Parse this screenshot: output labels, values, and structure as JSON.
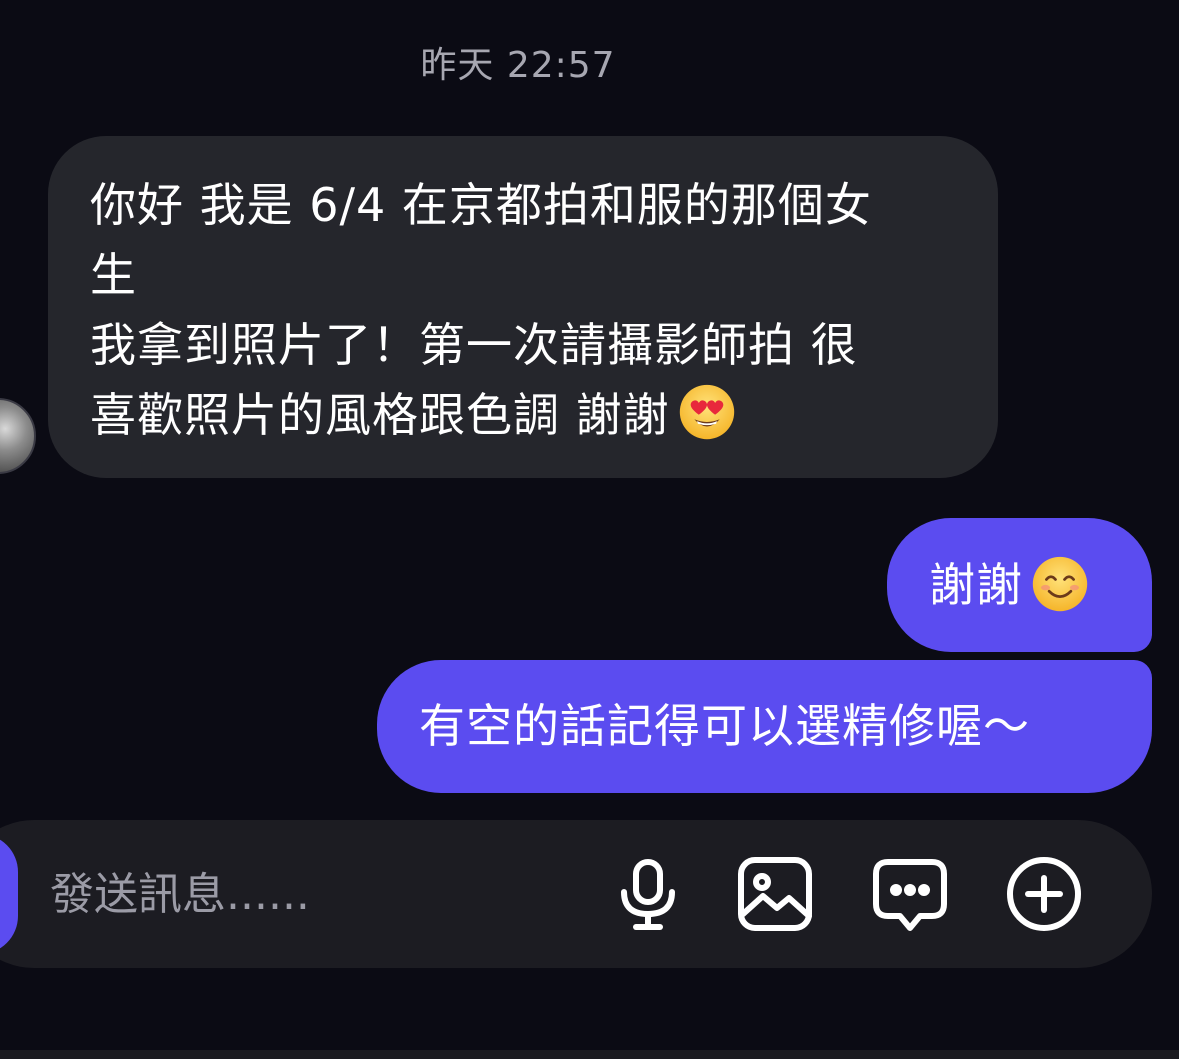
{
  "conversation": {
    "timestamp": "昨天 22:57",
    "incoming": {
      "lines": [
        "你好 我是 6/4 在京都拍和服的那個女",
        "生",
        "我拿到照片了！第一次請攝影師拍 很",
        "喜歡照片的風格跟色調 謝謝"
      ],
      "emoji": "heart-eyes-emoji"
    },
    "outgoing": [
      {
        "text": "謝謝",
        "emoji": "smiling-emoji"
      },
      {
        "text": "有空的話記得可以選精修喔～"
      }
    ]
  },
  "composer": {
    "placeholder": "發送訊息......",
    "icons": [
      "microphone-icon",
      "image-icon",
      "chat-bubble-icon",
      "plus-circle-icon"
    ]
  },
  "colors": {
    "background": "#0b0b14",
    "incoming_bubble": "#25262c",
    "outgoing_bubble": "#5b4cf0",
    "composer": "#1c1c22",
    "timestamp_text": "#a7a7b1"
  }
}
